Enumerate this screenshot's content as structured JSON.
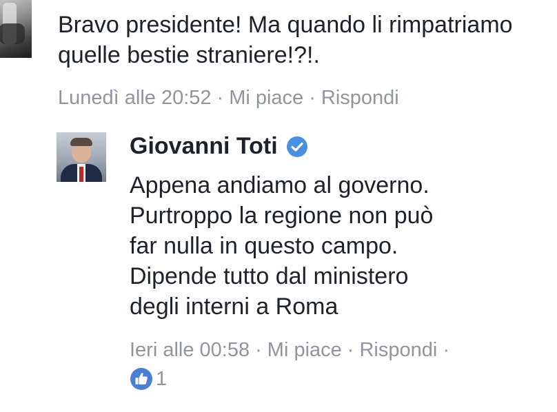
{
  "thread": {
    "top_comment": {
      "author_partial": "Bravo presidente",
      "text": "Bravo presidente! Ma quando li rimpatriamo quelle bestie straniere!?!.",
      "timestamp": "Lunedì alle 20:52",
      "like_label": "Mi piace",
      "reply_label": "Rispondi"
    },
    "reply": {
      "author": "Giovanni Toti",
      "verified": true,
      "text_lines": [
        "Appena andiamo al governo.",
        "Purtroppo la regione non può",
        "far nulla in questo campo.",
        "Dipende tutto dal ministero",
        "degli interni a Roma"
      ],
      "timestamp": "Ieri alle 00:58",
      "like_label": "Mi piace",
      "reply_label": "Rispondi",
      "trailing_separator": "·",
      "reaction_count": "1"
    }
  },
  "colors": {
    "text": "#1d2129",
    "meta": "#90949c",
    "verified_blue": "#4a90e2",
    "like_blue": "#4a7fd1"
  },
  "icons": {
    "verified": "verified-badge-icon",
    "reaction": "thumbs-up-icon"
  }
}
